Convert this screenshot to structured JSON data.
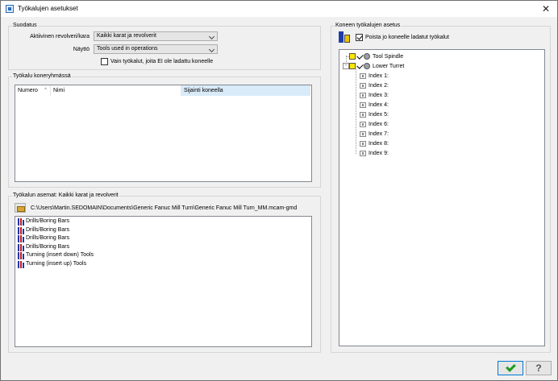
{
  "window": {
    "title": "Työkalujen asetukset"
  },
  "filter": {
    "label": "Suodatus",
    "turret_label": "Aktiivinen revolveri/kara",
    "turret_value": "Kaikki karat ja revolverit",
    "display_label": "Näyttö",
    "display_value": "Tools used in operations",
    "unloaded_only_label": "Vain työkalut, joita EI ole ladattu koneelle"
  },
  "tool_groups": {
    "label": "Työkalu koneryhmässä",
    "columns": [
      "Numero",
      "Nimi",
      "Sijainti koneella"
    ]
  },
  "tool_stations": {
    "label": "Työkalun asemat: Kaikki karat ja revolverit",
    "path": "C:\\Users\\Martin.SEDOMAIN\\Documents\\Generic Fanuc Mill Turn\\Generic Fanuc Mill Turn_MM.mcam-gmd",
    "items": [
      "Drills/Boring Bars",
      "Drills/Boring Bars",
      "Drills/Boring Bars",
      "Drills/Boring Bars",
      "Turning (insert down) Tools",
      "Turning (insert up) Tools"
    ]
  },
  "machine_setup": {
    "label": "Koneen työkalujen asetus",
    "remove_loaded_label": "Poista jo koneelle ladatut työkalut",
    "tree": {
      "spindle": "Tool Spindle",
      "turret": "Lower Turret",
      "indexes": [
        "Index 1:",
        "Index 2:",
        "Index 3:",
        "Index 4:",
        "Index 5:",
        "Index 6:",
        "Index 7:",
        "Index 8:",
        "Index 9:"
      ]
    }
  },
  "buttons": {
    "ok": "OK",
    "help": "?"
  }
}
